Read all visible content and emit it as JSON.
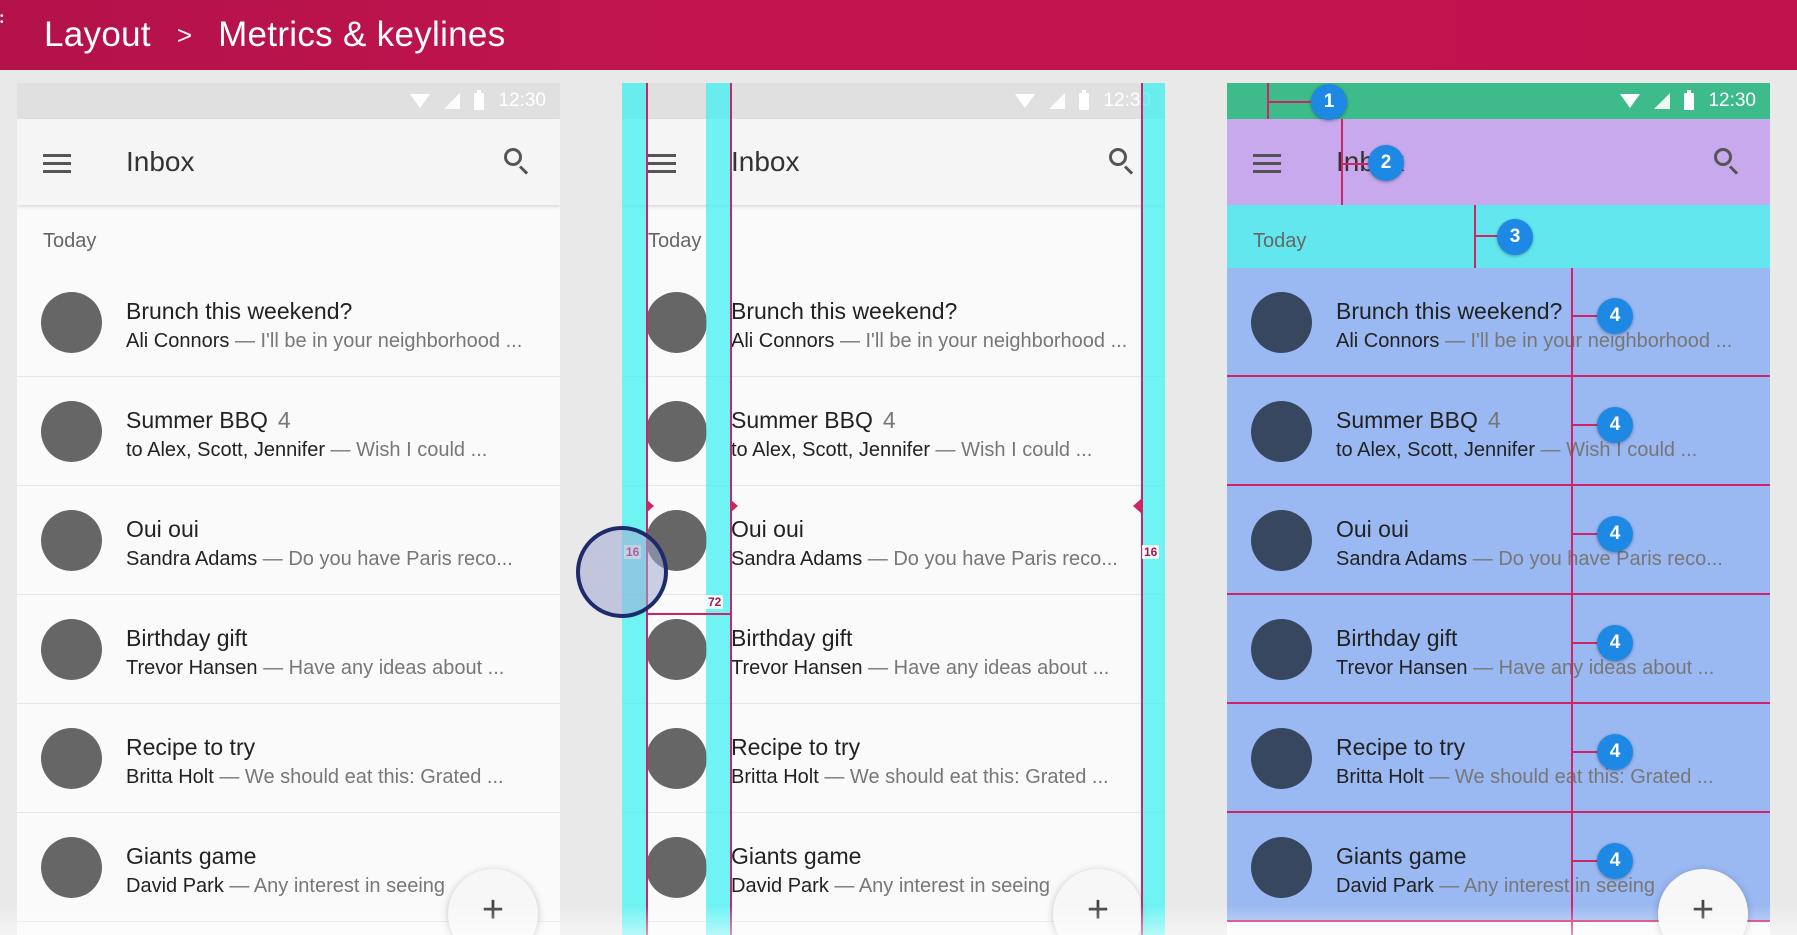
{
  "header": {
    "breadcrumb": [
      "Layout",
      "Metrics & keylines"
    ],
    "separator": ">"
  },
  "colors": {
    "header_bg": "#c0124d",
    "keyline": "#40f0f0",
    "keyline_line": "#cc2466",
    "zone_status": "#3dbb8a",
    "zone_appbar": "#c9a9ee",
    "zone_subheader": "#63e7ef",
    "zone_list": "#9ab8f2",
    "badge": "#1e88e5"
  },
  "status_bar": {
    "time": "12:30"
  },
  "app_bar": {
    "title": "Inbox"
  },
  "subheader": "Today",
  "messages": [
    {
      "subject": "Brunch this weekend?",
      "count": "",
      "sender": "Ali Connors",
      "snippet": " — I'll be in your neighborhood ..."
    },
    {
      "subject": "Summer BBQ",
      "count": "4",
      "sender": "to Alex, Scott, Jennifer",
      "snippet": " — Wish I could ..."
    },
    {
      "subject": "Oui oui",
      "count": "",
      "sender": "Sandra Adams",
      "snippet": " — Do you have Paris reco..."
    },
    {
      "subject": "Birthday gift",
      "count": "",
      "sender": "Trevor Hansen",
      "snippet": " — Have any ideas about ..."
    },
    {
      "subject": "Recipe to try",
      "count": "",
      "sender": "Britta Holt",
      "snippet": " — We should eat this: Grated ..."
    },
    {
      "subject": "Giants game",
      "count": "",
      "sender": "David Park",
      "snippet": " — Any interest in seeing"
    }
  ],
  "fab": {
    "label": "+"
  },
  "measurements": {
    "left_margin": "16",
    "right_margin": "16",
    "content_keyline": "72"
  },
  "badges": {
    "status": "1",
    "appbar": "2",
    "subheader": "3",
    "list_item": "4"
  },
  "icons": [
    "menu-icon",
    "search-icon",
    "wifi-icon",
    "signal-icon",
    "battery-icon",
    "add-icon"
  ]
}
